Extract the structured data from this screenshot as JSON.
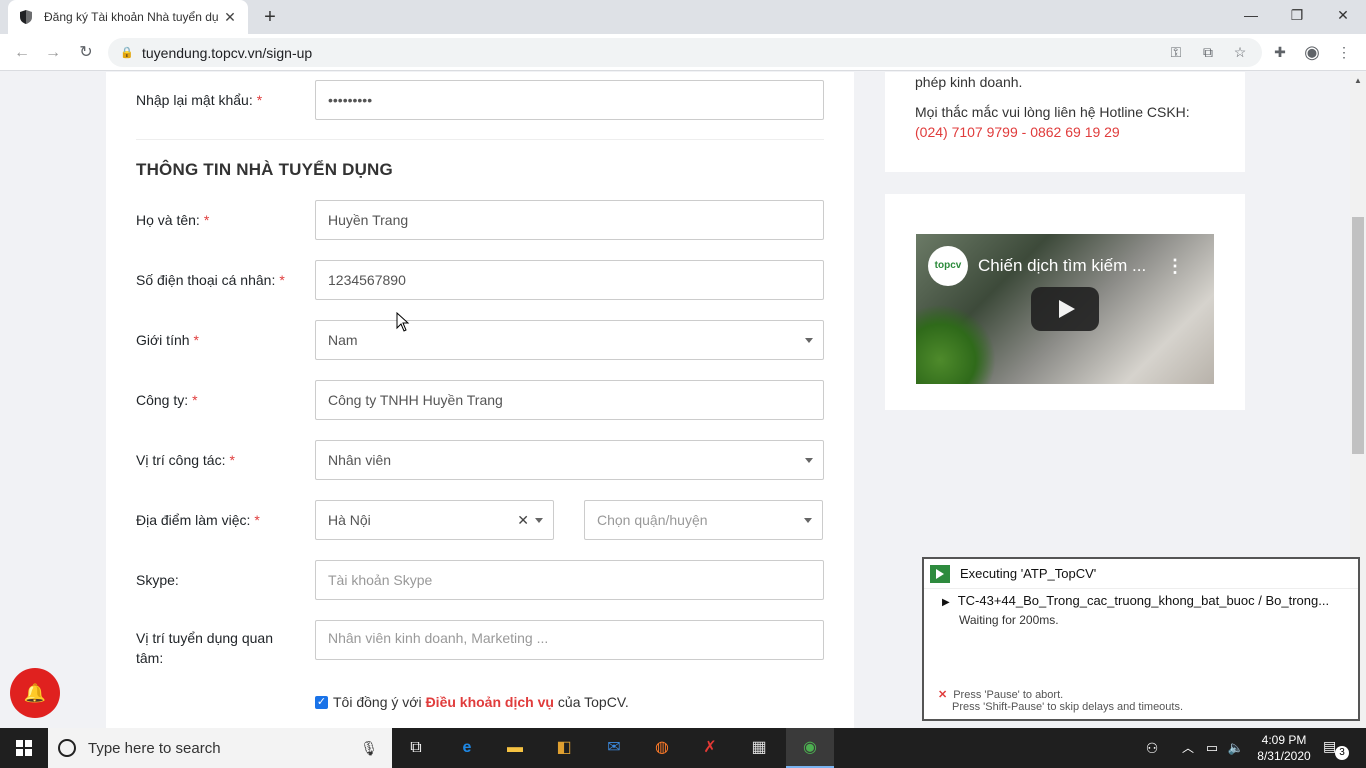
{
  "browser": {
    "tab_title": "Đăng ký Tài khoản Nhà tuyển dụ",
    "url": "tuyendung.topcv.vn/sign-up"
  },
  "form": {
    "confirm_password": {
      "label": "Nhập lại mật khẩu:",
      "value": "•••••••••"
    },
    "section_title": "THÔNG TIN NHÀ TUYỂN DỤNG",
    "fullname": {
      "label": "Họ và tên:",
      "value": "Huyền Trang"
    },
    "phone": {
      "label": "Số điện thoại cá nhân:",
      "value": "1234567890"
    },
    "gender": {
      "label": "Giới tính",
      "value": "Nam"
    },
    "company": {
      "label": "Công ty:",
      "value": "Công ty TNHH Huyền Trang"
    },
    "position": {
      "label": "Vị trí công tác:",
      "value": "Nhân viên"
    },
    "location": {
      "label": "Địa điểm làm việc:",
      "city": "Hà Nội",
      "district_placeholder": "Chọn quận/huyện"
    },
    "skype": {
      "label": "Skype:",
      "placeholder": "Tài khoản Skype"
    },
    "interest": {
      "label": "Vị trí tuyển dụng quan tâm:",
      "placeholder": "Nhân viên kinh doanh, Marketing ..."
    },
    "required_mark": "*",
    "agree": {
      "prefix": "Tôi đồng ý với",
      "terms": "Điều khoản dịch vụ",
      "suffix": "của TopCV."
    }
  },
  "sidebar": {
    "line1": "phép kinh doanh.",
    "line2": "Mọi thắc mắc vui lòng liên hệ Hotline CSKH:",
    "hotline": "(024) 7107 9799 - 0862 69 19 29",
    "video_title": "Chiến dịch tìm kiếm ...",
    "video_logo": "topcv"
  },
  "katalon": {
    "title": "Executing 'ATP_TopCV'",
    "step": "TC-43+44_Bo_Trong_cac_truong_khong_bat_buoc  / Bo_trong...",
    "status": "Waiting for 200ms.",
    "hint1": "Press 'Pause' to abort.",
    "hint2": "Press 'Shift-Pause' to skip delays and timeouts."
  },
  "taskbar": {
    "search_placeholder": "Type here to search",
    "time": "4:09 PM",
    "date": "8/31/2020",
    "notification_count": "3"
  },
  "colors": {
    "accent_red": "#e03c3c",
    "katalon_green": "#2e8b3e"
  }
}
